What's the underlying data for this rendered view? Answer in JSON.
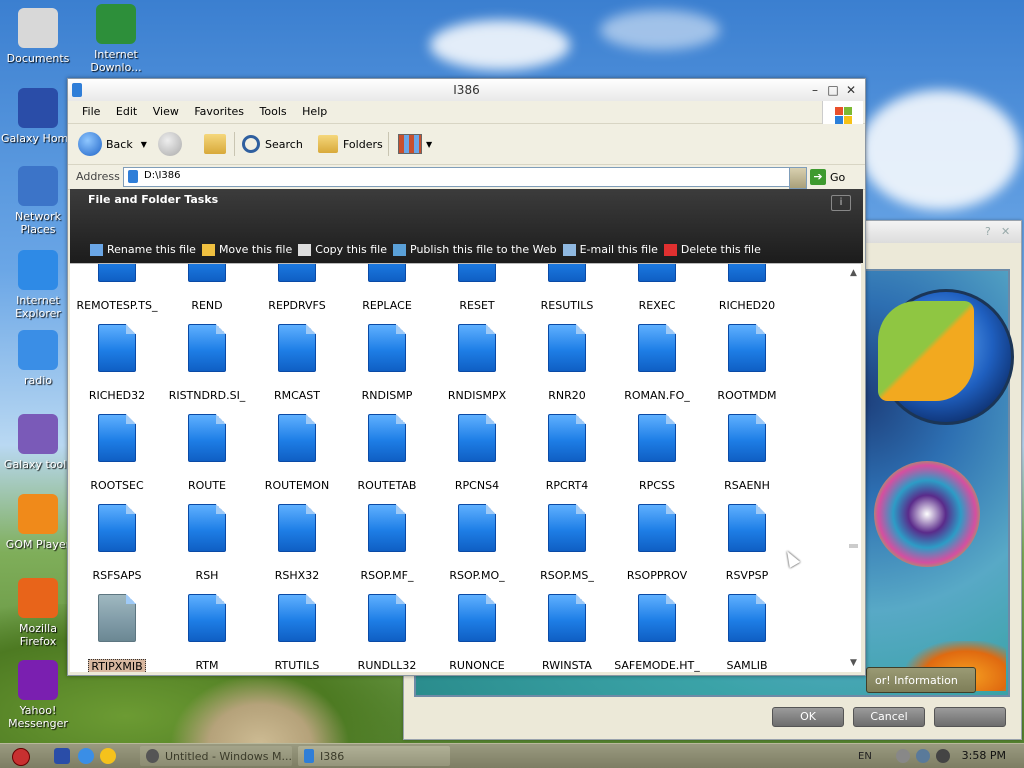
{
  "desktop": {
    "icons": [
      {
        "label": "Documents",
        "icon": "documents-icon"
      },
      {
        "label": "Internet Downlo...",
        "icon": "internet-download-manager-icon"
      },
      {
        "label": "Galaxy Home",
        "icon": "monitor-icon"
      },
      {
        "label": "Network Places",
        "icon": "network-places-icon"
      },
      {
        "label": "Internet Explorer",
        "icon": "internet-explorer-icon"
      },
      {
        "label": "radio",
        "icon": "radio-icon"
      },
      {
        "label": "Galaxy tools",
        "icon": "galaxy-tools-icon"
      },
      {
        "label": "GOM Player",
        "icon": "gom-player-icon"
      },
      {
        "label": "Mozilla Firefox",
        "icon": "firefox-icon"
      },
      {
        "label": "Yahoo! Messenger",
        "icon": "yahoo-messenger-icon"
      }
    ]
  },
  "background_dialog": {
    "info_button": "or! Information",
    "ok_label": "OK",
    "cancel_label": "Cancel",
    "third_label": ""
  },
  "window": {
    "title": "I386",
    "menu": [
      "File",
      "Edit",
      "View",
      "Favorites",
      "Tools",
      "Help"
    ],
    "toolbar": {
      "back_label": "Back",
      "search_label": "Search",
      "folders_label": "Folders"
    },
    "address": {
      "label": "Address",
      "value": "D:\\I386",
      "go_label": "Go"
    },
    "tasks": {
      "header": "File and Folder Tasks",
      "items": [
        {
          "label": "Rename this file",
          "icon": "rename-icon"
        },
        {
          "label": "Move this file",
          "icon": "move-icon"
        },
        {
          "label": "Copy this file",
          "icon": "copy-icon"
        },
        {
          "label": "Publish this file to the Web",
          "icon": "publish-icon"
        },
        {
          "label": "E-mail this file",
          "icon": "email-icon"
        },
        {
          "label": "Delete this file",
          "icon": "delete-icon"
        }
      ]
    },
    "files": [
      [
        "REMOTESP.TS_",
        "REND",
        "REPDRVFS",
        "REPLACE",
        "RESET",
        "RESUTILS",
        "REXEC",
        "RICHED20"
      ],
      [
        "RICHED32",
        "RISTNDRD.SI_",
        "RMCAST",
        "RNDISMP",
        "RNDISMPX",
        "RNR20",
        "ROMAN.FO_",
        "ROOTMDM"
      ],
      [
        "ROOTSEC",
        "ROUTE",
        "ROUTEMON",
        "ROUTETAB",
        "RPCNS4",
        "RPCRT4",
        "RPCSS",
        "RSAENH"
      ],
      [
        "RSFSAPS",
        "RSH",
        "RSHX32",
        "RSOP.MF_",
        "RSOP.MO_",
        "RSOP.MS_",
        "RSOPPROV",
        "RSVPSP"
      ],
      [
        "RTIPXMIB",
        "RTM",
        "RTUTILS",
        "RUNDLL32",
        "RUNONCE",
        "RWINSTA",
        "SAFEMODE.HT_",
        "SAMLIB"
      ]
    ],
    "selected_file": "RTIPXMIB"
  },
  "taskbar": {
    "tasks": [
      {
        "label": "Untitled - Windows M..."
      },
      {
        "label": "I386"
      }
    ],
    "language": "EN",
    "clock": "3:58 PM"
  },
  "colors": {
    "task_pane_bg": "#2a2a2a",
    "file_icon_blue": "#1e7ee6",
    "selection_bg": "#d9b8a0"
  }
}
